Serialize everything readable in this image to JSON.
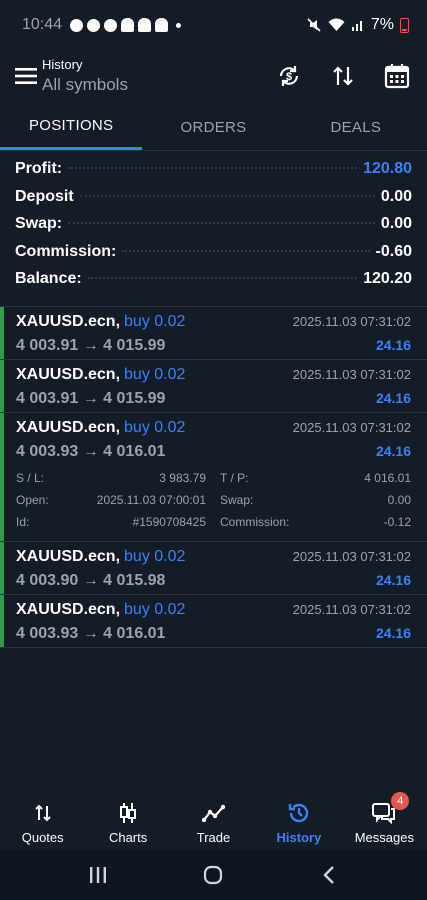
{
  "status": {
    "time": "10:44",
    "battery": "7%"
  },
  "header": {
    "title": "History",
    "subtitle": "All symbols"
  },
  "tabs": [
    {
      "label": "POSITIONS",
      "active": true
    },
    {
      "label": "ORDERS",
      "active": false
    },
    {
      "label": "DEALS",
      "active": false
    }
  ],
  "summary": [
    {
      "label": "Profit:",
      "value": "120.80"
    },
    {
      "label": "Deposit",
      "value": "0.00"
    },
    {
      "label": "Swap:",
      "value": "0.00"
    },
    {
      "label": "Commission:",
      "value": "-0.60"
    },
    {
      "label": "Balance:",
      "value": "120.20"
    }
  ],
  "positions": [
    {
      "symbol": "XAUUSD.ecn,",
      "side": "buy 0.02",
      "time": "2025.11.03 07:31:02",
      "prices": "4 003.91 → 4 015.99",
      "profit": "24.16"
    },
    {
      "symbol": "XAUUSD.ecn,",
      "side": "buy 0.02",
      "time": "2025.11.03 07:31:02",
      "prices": "4 003.91 → 4 015.99",
      "profit": "24.16"
    },
    {
      "symbol": "XAUUSD.ecn,",
      "side": "buy 0.02",
      "time": "2025.11.03 07:31:02",
      "prices": "4 003.93 → 4 016.01",
      "profit": "24.16",
      "details": {
        "sl_label": "S / L:",
        "sl": "3 983.79",
        "tp_label": "T / P:",
        "tp": "4 016.01",
        "open_label": "Open:",
        "open": "2025.11.03 07:00:01",
        "swap_label": "Swap:",
        "swap": "0.00",
        "id_label": "Id:",
        "id": "#1590708425",
        "commission_label": "Commission:",
        "commission": "-0.12"
      }
    },
    {
      "symbol": "XAUUSD.ecn,",
      "side": "buy 0.02",
      "time": "2025.11.03 07:31:02",
      "prices": "4 003.90 → 4 015.98",
      "profit": "24.16"
    },
    {
      "symbol": "XAUUSD.ecn,",
      "side": "buy 0.02",
      "time": "2025.11.03 07:31:02",
      "prices": "4 003.93 → 4 016.01",
      "profit": "24.16"
    }
  ],
  "nav": [
    {
      "label": "Quotes",
      "icon": "arrows-updown-icon"
    },
    {
      "label": "Charts",
      "icon": "candles-icon"
    },
    {
      "label": "Trade",
      "icon": "trade-line-icon"
    },
    {
      "label": "History",
      "icon": "history-icon",
      "active": true
    },
    {
      "label": "Messages",
      "icon": "messages-icon",
      "badge": "4"
    }
  ],
  "colors": {
    "accent": "#3b82f6",
    "background": "#141c28",
    "buy_bar": "#2ea043",
    "badge": "#e05a4e"
  }
}
